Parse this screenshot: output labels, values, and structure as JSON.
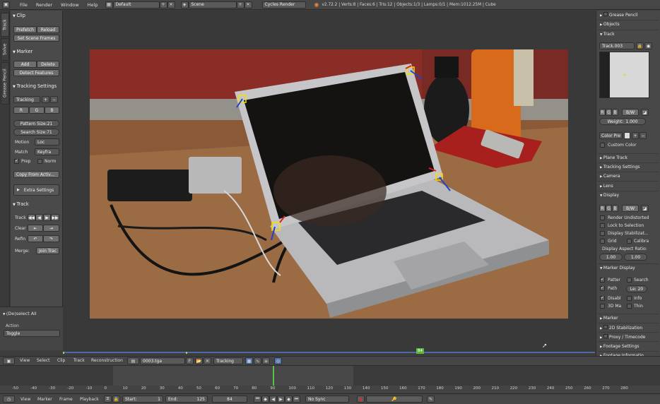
{
  "topbar": {
    "menus": [
      "File",
      "Render",
      "Window",
      "Help"
    ],
    "screen_layout": "Default",
    "scene": "Scene",
    "render_engine": "Cycles Render",
    "stats": "v2.72.2 | Verts:8 | Faces:6 | Tris:12 | Objects:1/3 | Lamps:0/1 | Mem:1012.25M | Cube"
  },
  "tabs": [
    "Track",
    "Solve",
    "Grease Pencil"
  ],
  "shelf": {
    "clip": {
      "title": "Clip",
      "prefetch": "Prefetch",
      "reload": "Reload",
      "set_scene_frames": "Set Scene Frames"
    },
    "marker": {
      "title": "Marker",
      "add": "Add",
      "delete": "Delete",
      "detect": "Detect Features"
    },
    "tracking_settings": {
      "title": "Tracking Settings",
      "preset": "Tracking",
      "channels": [
        "R",
        "G",
        "B"
      ],
      "pattern_size": "Pattern Size:21",
      "search_size": "Search Size:71",
      "motion_label": "Motion",
      "motion_value": "Loc",
      "match_label": "Match",
      "match_value": "Keyfra",
      "prepass": "Prep",
      "normalize": "Norm",
      "copy_from_active": "Copy From Activ...",
      "extra_settings": "Extra Settings"
    },
    "track": {
      "title": "Track",
      "track_label": "Track",
      "clear_label": "Clear",
      "refine_label": "Refin",
      "merge_label": "Merge:",
      "join": "Join Trac"
    }
  },
  "operator": {
    "title": "(De)select All",
    "action_label": "Action",
    "action_value": "Toggle"
  },
  "props": {
    "grease_pencil": "Grease Pencil",
    "objects": "Objects",
    "track": "Track",
    "track_name": "Track.003",
    "channels": [
      "R",
      "G",
      "B"
    ],
    "bw": "B/W",
    "weight": "Weight:",
    "weight_value": "1.000",
    "color_preset": "Color Pre",
    "custom_color": "Custom Color",
    "plane_track": "Plane Track",
    "tracking_settings": "Tracking Settings",
    "camera": "Camera",
    "lens": "Lens",
    "display": "Display",
    "render_undistorted": "Render Undistorted",
    "lock_to_selection": "Lock to Selection",
    "display_stabilization": "Display Stabilizat...",
    "grid": "Grid",
    "calibration": "Calibra",
    "display_aspect_ratio": "Display Aspect Ratio:",
    "aspect_x": "1.00",
    "aspect_y": "1.00",
    "marker_display": "Marker Display",
    "pattern": "Patter",
    "search": "Search",
    "path": "Path",
    "path_length": "Le: 20",
    "disabled": "Disabl",
    "info": "Info",
    "threed_markers": "3D Ma",
    "thin": "Thin",
    "marker": "Marker",
    "stabilization_2d": "2D Stabilization",
    "proxy_timecode": "Proxy / Timecode",
    "footage_settings": "Footage Settings",
    "footage_information": "Footage Informatio"
  },
  "clip_header": {
    "menus": [
      "View",
      "Select",
      "Clip",
      "Track",
      "Reconstruction"
    ],
    "clip_name": "0003.tga",
    "fake_user": "F",
    "mode": "Tracking"
  },
  "viewport": {
    "current_frame_badge": "84"
  },
  "timeline": {
    "ticks": [
      "-50",
      "-40",
      "-30",
      "-20",
      "-10",
      "0",
      "10",
      "20",
      "30",
      "40",
      "50",
      "60",
      "70",
      "80",
      "90",
      "100",
      "110",
      "120",
      "130",
      "140",
      "150",
      "160",
      "170",
      "180",
      "190",
      "200",
      "210",
      "220",
      "230",
      "240",
      "250",
      "260",
      "270",
      "280"
    ],
    "menus": [
      "View",
      "Marker",
      "Frame",
      "Playback"
    ],
    "start_label": "Start:",
    "start_value": "1",
    "end_label": "End:",
    "end_value": "125",
    "current_frame": "84",
    "sync": "No Sync"
  }
}
